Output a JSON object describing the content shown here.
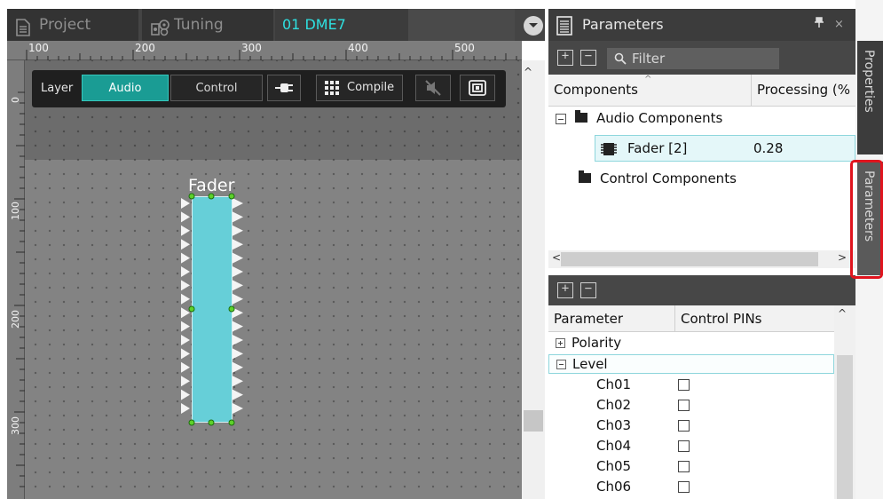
{
  "tabs": {
    "project": "Project",
    "tuning": "Tuning",
    "device": "01 DME7"
  },
  "ruler": {
    "top_marks": [
      "100",
      "200",
      "300",
      "400",
      "500"
    ],
    "left_marks": [
      "0",
      "100",
      "200",
      "300"
    ]
  },
  "toolbar": {
    "layer_label": "Layer",
    "audio_label": "Audio",
    "control_label": "Control",
    "compile_label": "Compile"
  },
  "canvas": {
    "component_label": "Fader"
  },
  "panel": {
    "title": "Parameters",
    "pin_icon": "pin-icon",
    "close_icon": "×",
    "filter_placeholder": "Filter",
    "components_header": "Components",
    "processing_header": "Processing (%",
    "tree": {
      "audio_group": "Audio Components",
      "fader_item": "Fader [2]",
      "fader_value": "0.28",
      "control_group": "Control Components"
    },
    "param_header": "Parameter",
    "pins_header": "Control PINs",
    "params": {
      "polarity": "Polarity",
      "level": "Level",
      "channels": [
        "Ch01",
        "Ch02",
        "Ch03",
        "Ch04",
        "Ch05",
        "Ch06"
      ]
    }
  },
  "side_tabs": {
    "properties": "Properties",
    "parameters": "Parameters"
  },
  "colors": {
    "accent_teal": "#1a9c94",
    "fader_fill": "#66cfd8",
    "device_tab_text": "#2ee0e0",
    "highlight_red": "#e0141e"
  }
}
